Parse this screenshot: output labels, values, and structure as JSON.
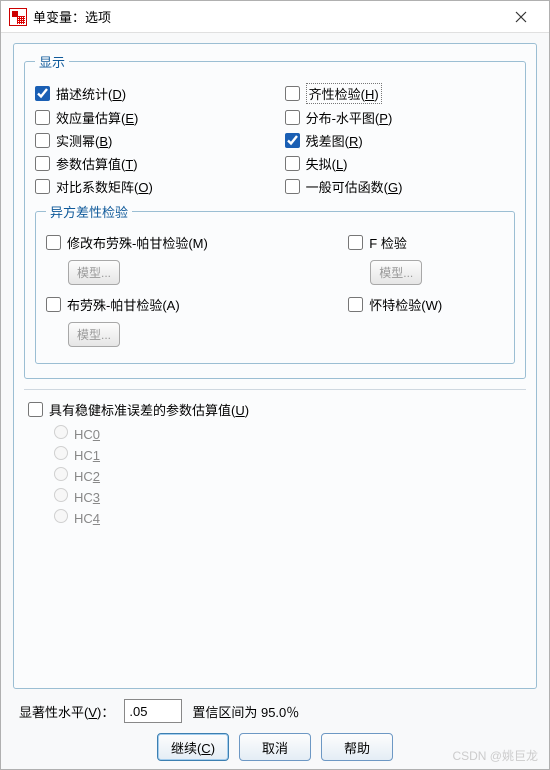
{
  "window": {
    "title": "单变量：选项"
  },
  "groups": {
    "display": "显示",
    "hetero": "异方差性检验"
  },
  "display": {
    "desc_stats": {
      "label": "描述统计(D)",
      "checked": true
    },
    "effect_size": {
      "label": "效应量估算(E)",
      "checked": false
    },
    "observed_power": {
      "label": "实测幂(B)",
      "checked": false
    },
    "param_est": {
      "label": "参数估算值(T)",
      "checked": false
    },
    "contrast_matrix": {
      "label": "对比系数矩阵(O)",
      "checked": false
    },
    "homogeneity": {
      "label": "齐性检验(H)",
      "checked": false
    },
    "spread_level": {
      "label": "分布-水平图(P)",
      "checked": false
    },
    "residual_plot": {
      "label": "残差图(R)",
      "checked": true
    },
    "lack_of_fit": {
      "label": "失拟(L)",
      "checked": false
    },
    "estimable_func": {
      "label": "一般可估函数(G)",
      "checked": false
    }
  },
  "hetero": {
    "mod_bp": {
      "label": "修改布劳殊-帕甘检验(M)",
      "checked": false
    },
    "f_test": {
      "label": "F 检验",
      "checked": false
    },
    "bp": {
      "label": "布劳殊-帕甘检验(A)",
      "checked": false
    },
    "white": {
      "label": "怀特检验(W)",
      "checked": false
    },
    "model_btn": "模型..."
  },
  "robust": {
    "label": "具有稳健标准误差的参数估算值(U)",
    "checked": false,
    "hc0": "HC0",
    "hc1": "HC1",
    "hc2": "HC2",
    "hc3": "HC3",
    "hc4": "HC4"
  },
  "sig": {
    "label": "显著性水平(V)：",
    "value": ".05",
    "ci_text": "置信区间为 95.0％"
  },
  "buttons": {
    "continue": "继续(C)",
    "cancel": "取消",
    "help": "帮助"
  },
  "watermark": "CSDN @姚巨龙"
}
